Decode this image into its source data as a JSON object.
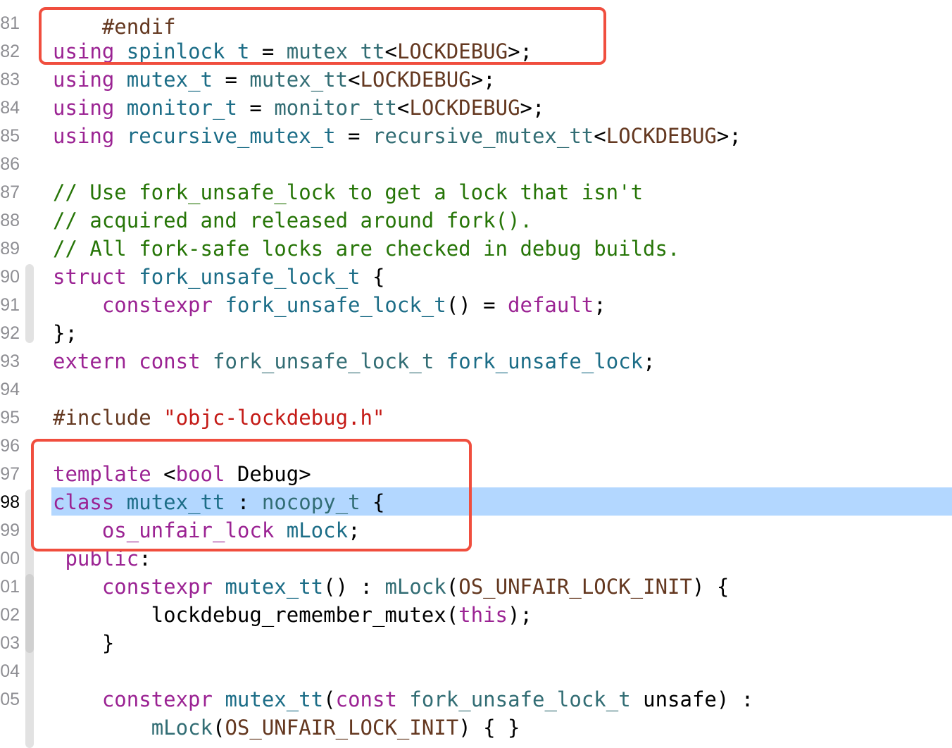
{
  "colors": {
    "keyword": "#9b2393",
    "type": "#1c6d87",
    "user_type": "#326d74",
    "macro": "#643820",
    "comment": "#267507",
    "string": "#c41a16",
    "highlight": "#b3d7ff",
    "annotation_box": "#f04e3e"
  },
  "editor": {
    "top_partial": "#endif",
    "line_numbers": [
      "81",
      "82",
      "83",
      "84",
      "85",
      "86",
      "87",
      "88",
      "89",
      "90",
      "91",
      "92",
      "93",
      "94",
      "95",
      "96",
      "97",
      "98",
      "99",
      "00",
      "01",
      "02",
      "03",
      "04",
      "05"
    ],
    "current_line_number": "98",
    "lines": [
      {
        "tokens": []
      },
      {
        "tokens": [
          {
            "t": "using",
            "c": "kw"
          },
          {
            "t": " ",
            "c": "pl"
          },
          {
            "t": "spinlock_t",
            "c": "typ"
          },
          {
            "t": " = ",
            "c": "pl"
          },
          {
            "t": "mutex_tt",
            "c": "usr"
          },
          {
            "t": "<",
            "c": "pl"
          },
          {
            "t": "LOCKDEBUG",
            "c": "mac"
          },
          {
            "t": ">;",
            "c": "pl"
          }
        ]
      },
      {
        "tokens": [
          {
            "t": "using",
            "c": "kw"
          },
          {
            "t": " ",
            "c": "pl"
          },
          {
            "t": "mutex_t",
            "c": "typ"
          },
          {
            "t": " = ",
            "c": "pl"
          },
          {
            "t": "mutex_tt",
            "c": "usr"
          },
          {
            "t": "<",
            "c": "pl"
          },
          {
            "t": "LOCKDEBUG",
            "c": "mac"
          },
          {
            "t": ">;",
            "c": "pl"
          }
        ]
      },
      {
        "tokens": [
          {
            "t": "using",
            "c": "kw"
          },
          {
            "t": " ",
            "c": "pl"
          },
          {
            "t": "monitor_t",
            "c": "typ"
          },
          {
            "t": " = ",
            "c": "pl"
          },
          {
            "t": "monitor_tt",
            "c": "usr"
          },
          {
            "t": "<",
            "c": "pl"
          },
          {
            "t": "LOCKDEBUG",
            "c": "mac"
          },
          {
            "t": ">;",
            "c": "pl"
          }
        ]
      },
      {
        "tokens": [
          {
            "t": "using",
            "c": "kw"
          },
          {
            "t": " ",
            "c": "pl"
          },
          {
            "t": "recursive_mutex_t",
            "c": "typ"
          },
          {
            "t": " = ",
            "c": "pl"
          },
          {
            "t": "recursive_mutex_tt",
            "c": "usr"
          },
          {
            "t": "<",
            "c": "pl"
          },
          {
            "t": "LOCKDEBUG",
            "c": "mac"
          },
          {
            "t": ">;",
            "c": "pl"
          }
        ]
      },
      {
        "tokens": []
      },
      {
        "tokens": [
          {
            "t": "// Use fork_unsafe_lock to get a lock that isn't",
            "c": "cmt"
          }
        ]
      },
      {
        "tokens": [
          {
            "t": "// acquired and released around fork().",
            "c": "cmt"
          }
        ]
      },
      {
        "tokens": [
          {
            "t": "// All fork-safe locks are checked in debug builds.",
            "c": "cmt"
          }
        ]
      },
      {
        "tokens": [
          {
            "t": "struct",
            "c": "kw"
          },
          {
            "t": " ",
            "c": "pl"
          },
          {
            "t": "fork_unsafe_lock_t",
            "c": "typ"
          },
          {
            "t": " {",
            "c": "pl"
          }
        ]
      },
      {
        "tokens": [
          {
            "t": "    ",
            "c": "pl"
          },
          {
            "t": "constexpr",
            "c": "kw"
          },
          {
            "t": " ",
            "c": "pl"
          },
          {
            "t": "fork_unsafe_lock_t",
            "c": "typ"
          },
          {
            "t": "() = ",
            "c": "pl"
          },
          {
            "t": "default",
            "c": "kw"
          },
          {
            "t": ";",
            "c": "pl"
          }
        ]
      },
      {
        "tokens": [
          {
            "t": "};",
            "c": "pl"
          }
        ]
      },
      {
        "tokens": [
          {
            "t": "extern",
            "c": "kw"
          },
          {
            "t": " ",
            "c": "pl"
          },
          {
            "t": "const",
            "c": "kw"
          },
          {
            "t": " ",
            "c": "pl"
          },
          {
            "t": "fork_unsafe_lock_t",
            "c": "usr"
          },
          {
            "t": " ",
            "c": "pl"
          },
          {
            "t": "fork_unsafe_lock",
            "c": "typ"
          },
          {
            "t": ";",
            "c": "pl"
          }
        ]
      },
      {
        "tokens": []
      },
      {
        "tokens": [
          {
            "t": "#include ",
            "c": "pp"
          },
          {
            "t": "\"objc-lockdebug.h\"",
            "c": "str"
          }
        ]
      },
      {
        "tokens": []
      },
      {
        "tokens": [
          {
            "t": "template",
            "c": "kw"
          },
          {
            "t": " <",
            "c": "pl"
          },
          {
            "t": "bool",
            "c": "kw"
          },
          {
            "t": " Debug>",
            "c": "pl"
          }
        ]
      },
      {
        "tokens": [
          {
            "t": "class",
            "c": "kw"
          },
          {
            "t": " ",
            "c": "pl"
          },
          {
            "t": "mutex_tt",
            "c": "typ"
          },
          {
            "t": " : ",
            "c": "pl"
          },
          {
            "t": "nocopy_t",
            "c": "usr"
          },
          {
            "t": " {",
            "c": "pl"
          }
        ]
      },
      {
        "tokens": [
          {
            "t": "    ",
            "c": "pl"
          },
          {
            "t": "os_unfair_lock",
            "c": "kw"
          },
          {
            "t": " ",
            "c": "pl"
          },
          {
            "t": "mLock",
            "c": "typ"
          },
          {
            "t": ";",
            "c": "pl"
          }
        ]
      },
      {
        "tokens": [
          {
            "t": " ",
            "c": "pl"
          },
          {
            "t": "public",
            "c": "kw"
          },
          {
            "t": ":",
            "c": "pl"
          }
        ]
      },
      {
        "tokens": [
          {
            "t": "    ",
            "c": "pl"
          },
          {
            "t": "constexpr",
            "c": "kw"
          },
          {
            "t": " ",
            "c": "pl"
          },
          {
            "t": "mutex_tt",
            "c": "typ"
          },
          {
            "t": "() : ",
            "c": "pl"
          },
          {
            "t": "mLock",
            "c": "ivar"
          },
          {
            "t": "(",
            "c": "pl"
          },
          {
            "t": "OS_UNFAIR_LOCK_INIT",
            "c": "mac"
          },
          {
            "t": ") {",
            "c": "pl"
          }
        ]
      },
      {
        "tokens": [
          {
            "t": "        lockdebug_remember_mutex(",
            "c": "pl"
          },
          {
            "t": "this",
            "c": "kw"
          },
          {
            "t": ");",
            "c": "pl"
          }
        ]
      },
      {
        "tokens": [
          {
            "t": "    }",
            "c": "pl"
          }
        ]
      },
      {
        "tokens": []
      },
      {
        "tokens": [
          {
            "t": "    ",
            "c": "pl"
          },
          {
            "t": "constexpr",
            "c": "kw"
          },
          {
            "t": " ",
            "c": "pl"
          },
          {
            "t": "mutex_tt",
            "c": "typ"
          },
          {
            "t": "(",
            "c": "pl"
          },
          {
            "t": "const",
            "c": "kw"
          },
          {
            "t": " ",
            "c": "pl"
          },
          {
            "t": "fork_unsafe_lock_t",
            "c": "usr"
          },
          {
            "t": " unsafe) :",
            "c": "pl"
          }
        ]
      },
      {
        "tokens": [
          {
            "t": "        ",
            "c": "pl"
          },
          {
            "t": "mLock",
            "c": "ivar"
          },
          {
            "t": "(",
            "c": "pl"
          },
          {
            "t": "OS_UNFAIR_LOCK_INIT",
            "c": "mac"
          },
          {
            "t": ") { }",
            "c": "pl"
          }
        ]
      }
    ]
  }
}
